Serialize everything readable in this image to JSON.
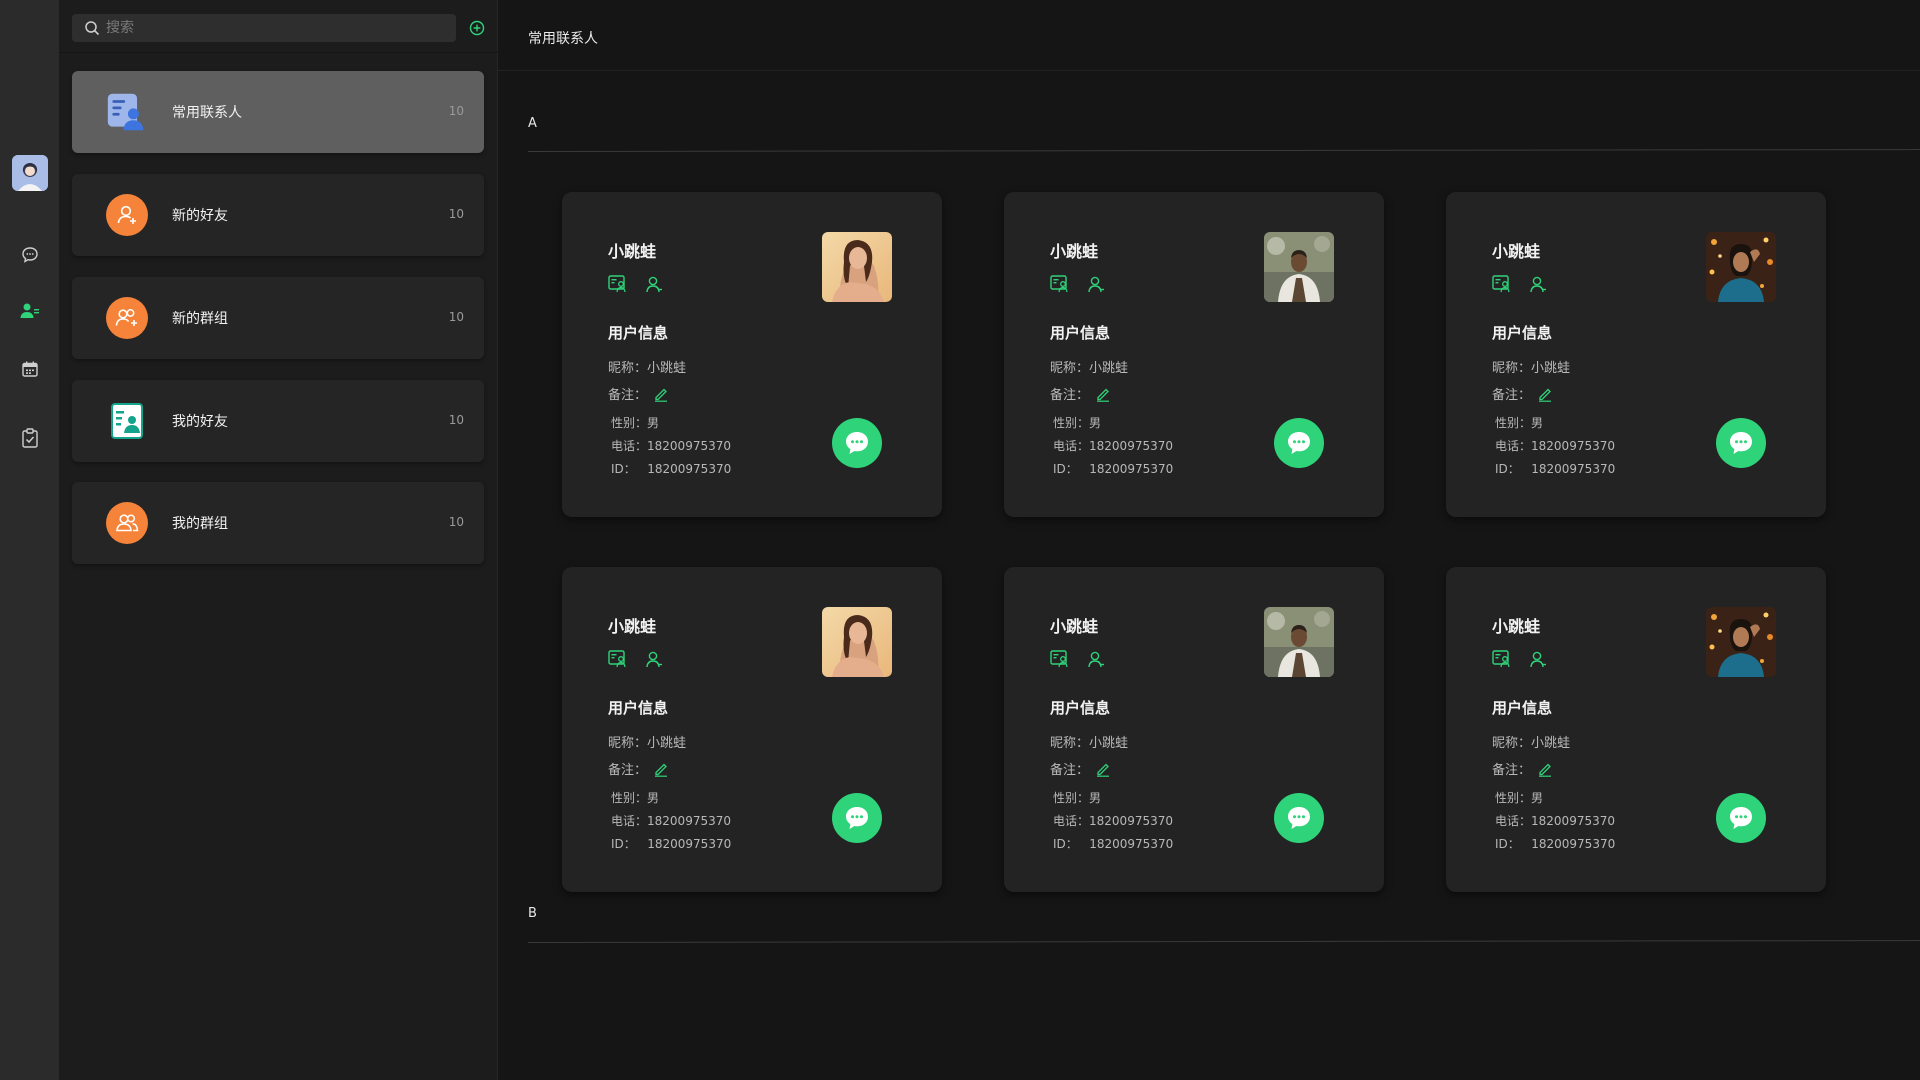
{
  "rail": {
    "icons": [
      "avatar",
      "chat-icon",
      "contacts-icon",
      "calendar-icon",
      "clipboard-icon"
    ],
    "accent": "#2fd37a"
  },
  "search": {
    "placeholder": "搜索"
  },
  "nav": [
    {
      "label": "常用联系人",
      "count": "10",
      "icon": "contacts-card-icon",
      "active": true
    },
    {
      "label": "新的好友",
      "count": "10",
      "icon": "add-user-icon"
    },
    {
      "label": "新的群组",
      "count": "10",
      "icon": "add-group-icon"
    },
    {
      "label": "我的好友",
      "count": "10",
      "icon": "friend-card-icon"
    },
    {
      "label": "我的群组",
      "count": "10",
      "icon": "group-icon"
    }
  ],
  "main": {
    "title": "常用联系人",
    "sections": [
      {
        "letter": "A"
      },
      {
        "letter": "B"
      }
    ]
  },
  "cards": [
    {
      "name": "小跳蛙",
      "section_title": "用户信息",
      "nickname_label": "昵称：",
      "nickname": "小跳蛙",
      "remark_label": "备注：",
      "gender_label": "性别：",
      "gender": "男",
      "phone_label": "电话：",
      "phone": "18200975370",
      "id_label": "ID：",
      "id": "18200975370",
      "photo": "woman-portrait"
    },
    {
      "name": "小跳蛙",
      "section_title": "用户信息",
      "nickname_label": "昵称：",
      "nickname": "小跳蛙",
      "remark_label": "备注：",
      "gender_label": "性别：",
      "gender": "男",
      "phone_label": "电话：",
      "phone": "18200975370",
      "id_label": "ID：",
      "id": "18200975370",
      "photo": "man-portrait"
    },
    {
      "name": "小跳蛙",
      "section_title": "用户信息",
      "nickname_label": "昵称：",
      "nickname": "小跳蛙",
      "remark_label": "备注：",
      "gender_label": "性别：",
      "gender": "男",
      "phone_label": "电话：",
      "phone": "18200975370",
      "id_label": "ID：",
      "id": "18200975370",
      "photo": "woman-lights-portrait"
    },
    {
      "name": "小跳蛙",
      "section_title": "用户信息",
      "nickname_label": "昵称：",
      "nickname": "小跳蛙",
      "remark_label": "备注：",
      "gender_label": "性别：",
      "gender": "男",
      "phone_label": "电话：",
      "phone": "18200975370",
      "id_label": "ID：",
      "id": "18200975370",
      "photo": "woman-portrait"
    },
    {
      "name": "小跳蛙",
      "section_title": "用户信息",
      "nickname_label": "昵称：",
      "nickname": "小跳蛙",
      "remark_label": "备注：",
      "gender_label": "性别：",
      "gender": "男",
      "phone_label": "电话：",
      "phone": "18200975370",
      "id_label": "ID：",
      "id": "18200975370",
      "photo": "man-portrait"
    },
    {
      "name": "小跳蛙",
      "section_title": "用户信息",
      "nickname_label": "昵称：",
      "nickname": "小跳蛙",
      "remark_label": "备注：",
      "gender_label": "性别：",
      "gender": "男",
      "phone_label": "电话：",
      "phone": "18200975370",
      "id_label": "ID：",
      "id": "18200975370",
      "photo": "woman-lights-portrait"
    }
  ]
}
